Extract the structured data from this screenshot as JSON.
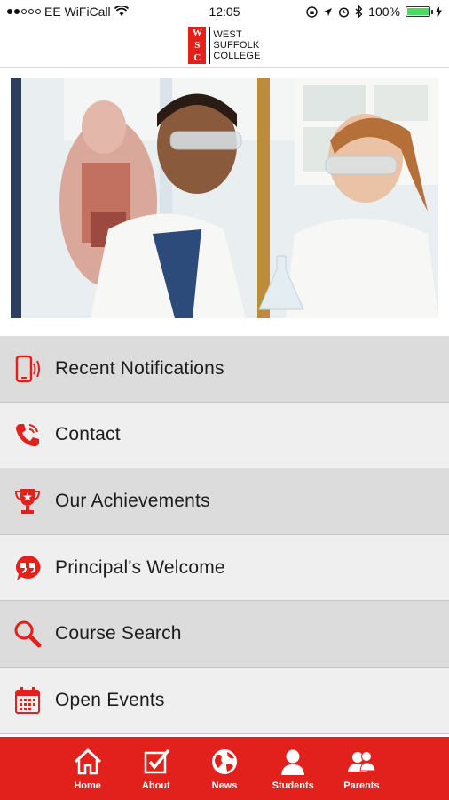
{
  "status_bar": {
    "carrier": "EE WiFiCall",
    "time": "12:05",
    "battery": "100%",
    "battery_level": 1.0
  },
  "header": {
    "logo_mark": [
      "W",
      "S",
      "C"
    ],
    "logo_lines": [
      "WEST",
      "SUFFOLK",
      "COLLEGE"
    ]
  },
  "menu": {
    "items": [
      {
        "label": "Recent Notifications",
        "icon": "phone-vibrate-icon"
      },
      {
        "label": "Contact",
        "icon": "phone-call-icon"
      },
      {
        "label": "Our Achievements",
        "icon": "trophy-icon"
      },
      {
        "label": "Principal's Welcome",
        "icon": "quote-bubble-icon"
      },
      {
        "label": "Course Search",
        "icon": "search-icon"
      },
      {
        "label": "Open Events",
        "icon": "calendar-icon"
      }
    ]
  },
  "tabs": [
    {
      "label": "Home",
      "icon": "home-icon"
    },
    {
      "label": "About",
      "icon": "checkbox-icon"
    },
    {
      "label": "News",
      "icon": "globe-icon"
    },
    {
      "label": "Students",
      "icon": "user-icon"
    },
    {
      "label": "Parents",
      "icon": "users-icon"
    }
  ],
  "colors": {
    "brand_red": "#e3211c",
    "menu_dark": "#dcdcdc",
    "menu_light": "#efefef"
  }
}
